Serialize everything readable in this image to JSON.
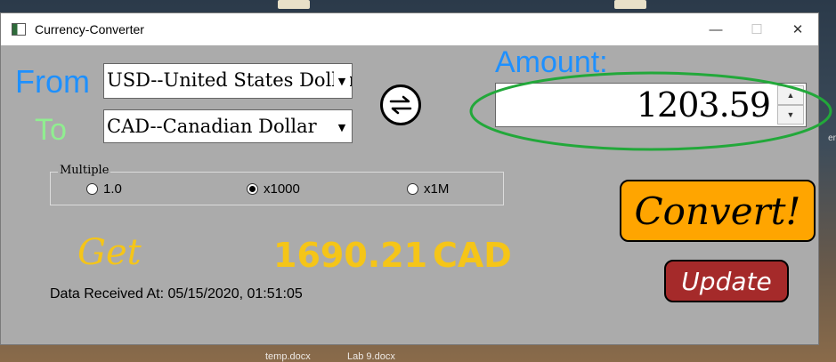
{
  "window": {
    "title": "Currency-Converter",
    "minimize_glyph": "—",
    "maximize_glyph": "☐",
    "close_glyph": "✕"
  },
  "from": {
    "label": "From",
    "selected": "USD--United States Dollar"
  },
  "to": {
    "label": "To",
    "selected": "CAD--Canadian Dollar"
  },
  "amount": {
    "label": "Amount:",
    "value": "1203.59"
  },
  "multiple": {
    "title": "Multiple",
    "options": [
      {
        "label": "1.0",
        "checked": false
      },
      {
        "label": "x1000",
        "checked": true
      },
      {
        "label": "x1M",
        "checked": false
      }
    ]
  },
  "result": {
    "prefix": "Get",
    "value": "1690.21",
    "currency": "CAD"
  },
  "data_received": "Data Received At: 05/15/2020, 01:51:05",
  "buttons": {
    "convert": "Convert!",
    "update": "Update"
  },
  "desktop": {
    "file1": "temp.docx",
    "file2": "Lab 9.docx"
  },
  "colors": {
    "from_label": "#1e90ff",
    "to_label": "#90ee90",
    "amount_label": "#1e90ff",
    "result": "#f5c518",
    "convert_bg": "#ffa500",
    "update_bg": "#a52a2a",
    "annotation_ellipse": "#22a83a"
  }
}
